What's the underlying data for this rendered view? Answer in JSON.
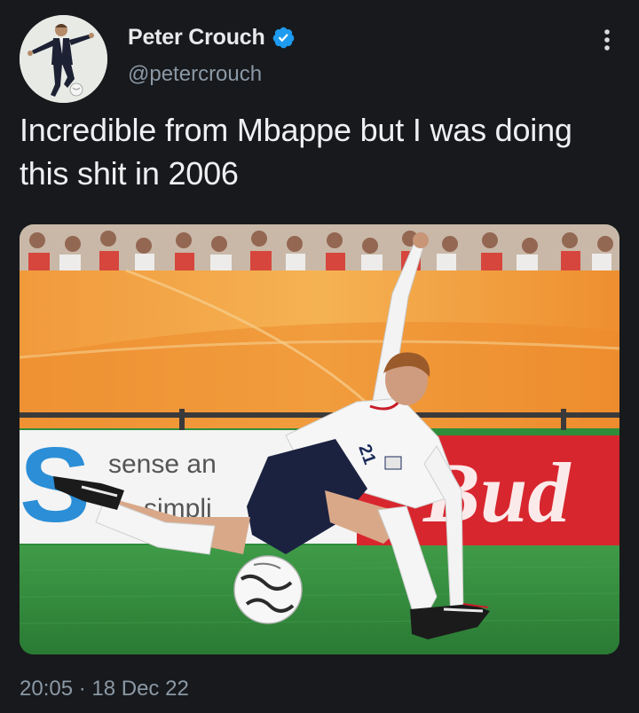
{
  "author": {
    "display_name": "Peter Crouch",
    "handle": "@petercrouch",
    "verified": true,
    "verified_color": "#1d9bf0",
    "avatar_icon": "profile-photo"
  },
  "tweet": {
    "text": "Incredible from Mbappe but I was doing this shit in 2006",
    "timestamp": "20:05 · 18 Dec 22"
  },
  "media": {
    "type": "photo",
    "shirt_number": "21",
    "ad_board_text_1": "sense an",
    "ad_board_text_2": "simpli",
    "ad_board_brand": "Bud"
  },
  "menu_icon": "more-dots-icon",
  "colors": {
    "background": "#17191c",
    "primary_text": "#e7e9ea",
    "secondary_text": "#8b98a5"
  }
}
